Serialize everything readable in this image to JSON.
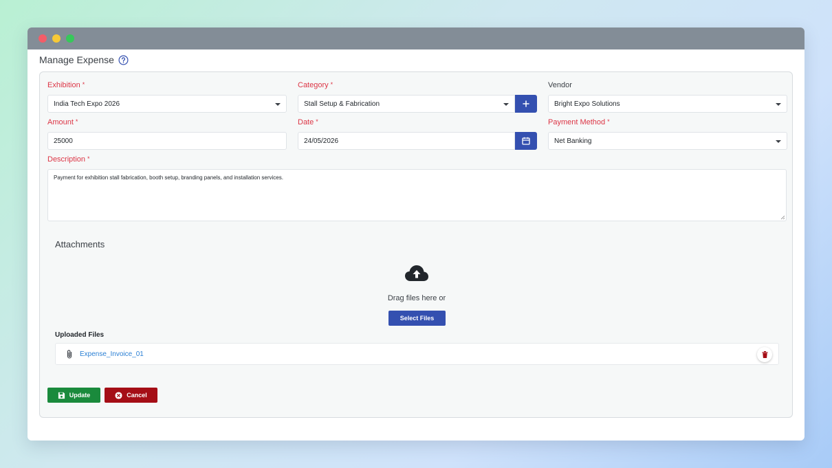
{
  "page": {
    "title": "Manage Expense"
  },
  "form": {
    "exhibition": {
      "label": "Exhibition",
      "required_mark": "*",
      "value": "India Tech Expo 2026"
    },
    "category": {
      "label": "Category",
      "required_mark": "*",
      "value": "Stall Setup & Fabrication",
      "add_label": "+"
    },
    "vendor": {
      "label": "Vendor",
      "value": "Bright Expo Solutions"
    },
    "amount": {
      "label": "Amount",
      "required_mark": "*",
      "value": "25000"
    },
    "date": {
      "label": "Date",
      "required_mark": "*",
      "value": "24/05/2026"
    },
    "payment_method": {
      "label": "Payment Method",
      "required_mark": "*",
      "value": "Net Banking"
    },
    "description": {
      "label": "Description",
      "required_mark": "*",
      "value": "Payment for exhibition stall fabrication, booth setup, branding panels, and installation services."
    }
  },
  "attachments": {
    "title": "Attachments",
    "drag_text": "Drag files here or",
    "select_label": "Select Files",
    "uploaded_title": "Uploaded Files",
    "files": [
      {
        "name": "Expense_Invoice_01"
      }
    ]
  },
  "actions": {
    "update_label": "Update",
    "cancel_label": "Cancel"
  },
  "colors": {
    "primary": "#3450b0",
    "success": "#1a8a3c",
    "danger": "#a50e16",
    "required": "#dc3545",
    "link": "#2a7fd4"
  }
}
